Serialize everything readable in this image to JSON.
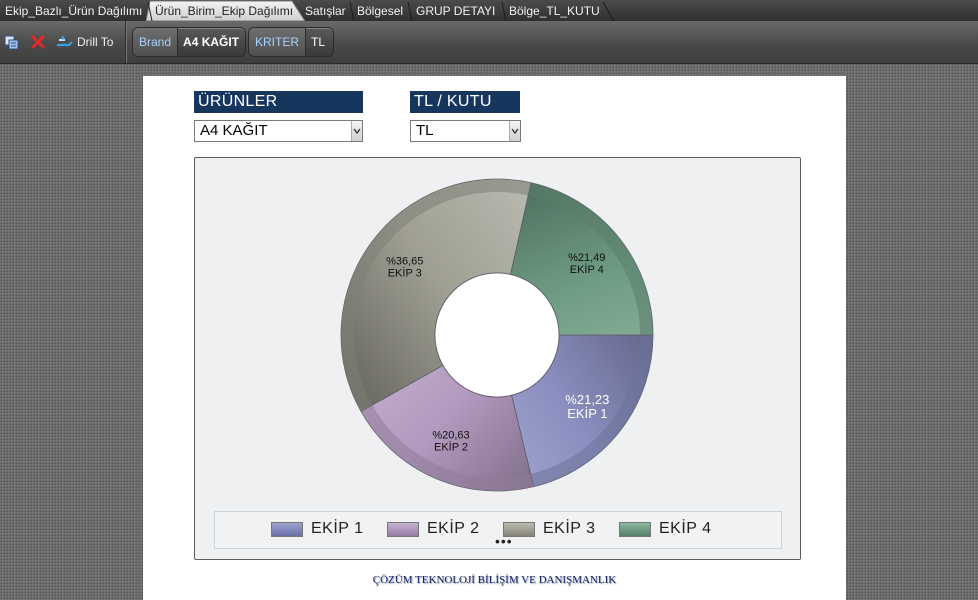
{
  "tabs": [
    {
      "label": "Ekip_Bazlı_Ürün Dağılımı",
      "active": false
    },
    {
      "label": "Ürün_Birim_Ekip Dağılımı",
      "active": true
    },
    {
      "label": "Satışlar",
      "active": false
    },
    {
      "label": "Bölgesel",
      "active": false
    },
    {
      "label": "GRUP DETAYI",
      "active": false
    },
    {
      "label": "Bölge_TL_KUTU",
      "active": false
    }
  ],
  "toolbar": {
    "drill_label": "Drill To",
    "selections": [
      {
        "key": "Brand",
        "value": "A4 KAĞIT"
      },
      {
        "key": "KRITER",
        "value": "TL"
      }
    ]
  },
  "filters": {
    "products": {
      "title": "ÜRÜNLER",
      "value": "A4 KAĞIT"
    },
    "unit": {
      "title": "TL / KUTU",
      "value": "TL"
    }
  },
  "chart_data": {
    "type": "pie",
    "donut": true,
    "slices": [
      {
        "name": "EKİP 1",
        "percent_label": "%21,23",
        "value": 21.23,
        "color": "#8a8fc0"
      },
      {
        "name": "EKİP 2",
        "percent_label": "%20,63",
        "value": 20.63,
        "color": "#b39abf"
      },
      {
        "name": "EKİP 3",
        "percent_label": "%36,65",
        "value": 36.65,
        "color": "#a09f93"
      },
      {
        "name": "EKİP 4",
        "percent_label": "%21,49",
        "value": 21.49,
        "color": "#6f9c84"
      }
    ],
    "legend": [
      "EKİP 1",
      "EKİP 2",
      "EKİP 3",
      "EKİP 4"
    ],
    "legend_placement": "bottom",
    "legend_more": "•••"
  },
  "footer": "ÇÖZÜM TEKNOLOJİ BİLİŞİM VE DANIŞMANLIK"
}
